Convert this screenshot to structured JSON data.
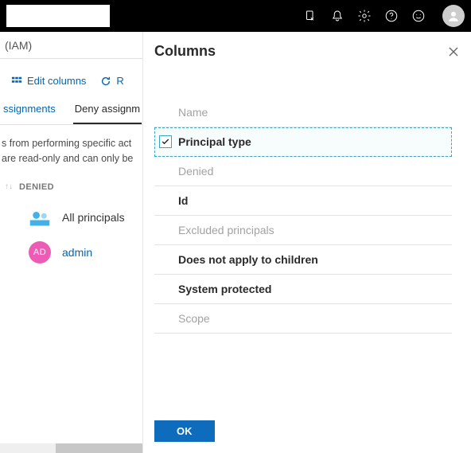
{
  "breadcrumb": "(IAM)",
  "toolbar": {
    "edit_columns": "Edit columns",
    "refresh": "R"
  },
  "tabs": {
    "assignments": "ssignments",
    "deny": "Deny assignm"
  },
  "description": "s from performing specific act\nare read-only and can only be",
  "columnHeader": "DENIED",
  "rows": {
    "allPrincipals": "All principals",
    "adminBadge": "AD",
    "admin": "admin"
  },
  "panel": {
    "title": "Columns",
    "items": {
      "name": "Name",
      "principalType": "Principal type",
      "denied": "Denied",
      "id": "Id",
      "excluded": "Excluded principals",
      "notApply": "Does not apply to children",
      "systemProtected": "System protected",
      "scope": "Scope"
    },
    "okLabel": "OK"
  }
}
